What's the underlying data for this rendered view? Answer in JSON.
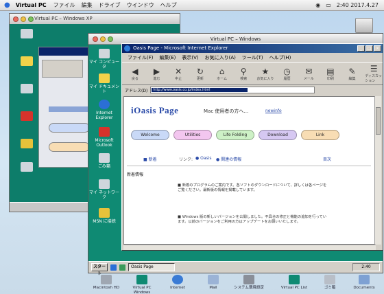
{
  "mac_menubar": {
    "app_name": "Virtual PC",
    "menus": [
      "ファイル",
      "編集",
      "ドライブ",
      "ウインドウ",
      "ヘルプ"
    ],
    "clock": "2:40 2017.4.27"
  },
  "back_window": {
    "title": "Virtual PC – Windows XP"
  },
  "front_window": {
    "title": "Virtual PC – Windows"
  },
  "desktop_icons": [
    {
      "label": "マイ コンピュータ",
      "color": "#cfd6dc"
    },
    {
      "label": "マイ ドキュメント",
      "color": "#f2d24a"
    },
    {
      "label": "Internet Explorer",
      "color": "#2b6fd6"
    },
    {
      "label": "Microsoft Outlook",
      "color": "#d6332b"
    },
    {
      "label": "ごみ箱",
      "color": "#cfd6dc"
    },
    {
      "label": "マイ ネットワーク",
      "color": "#cfd6dc"
    },
    {
      "label": "MSN に接続",
      "color": "#e6c23a"
    }
  ],
  "ie": {
    "title": "Oasis Page - Microsoft Internet Explorer",
    "menu": [
      "ファイル(F)",
      "編集(E)",
      "表示(V)",
      "お気に入り(A)",
      "ツール(T)",
      "ヘルプ(H)"
    ],
    "toolbar": [
      "戻る",
      "進む",
      "中止",
      "更新",
      "ホーム",
      "検索",
      "お気に入り",
      "履歴",
      "メール",
      "印刷",
      "編集",
      "ディスカッション"
    ],
    "address_label": "アドレス(D)",
    "address_value": "http://www.oasis.co.jp/index.html",
    "page": {
      "brand": "iOasis Page",
      "brand_sub": "Mac 使用者の方へ…",
      "brand_link": "newinfo",
      "pills": [
        {
          "label": "Welcome",
          "color": "#c9d9f7"
        },
        {
          "label": "Utilities",
          "color": "#f3c6ef"
        },
        {
          "label": "Life Folding",
          "color": "#cdf1c6"
        },
        {
          "label": "Download",
          "color": "#d6c8f2"
        },
        {
          "label": "Link",
          "color": "#f8ddb4"
        }
      ],
      "nav": [
        "■ 新着",
        "リンク:",
        "● Oasis",
        "● 関連の情報"
      ],
      "nav_right": "目次",
      "section_title": "新着情報",
      "paragraphs": [
        "■ 新着のプログラムのご案内です。各ソフトのダウンロードについて、詳しくは各ページをご覧ください。最新版の情報を掲載しています。",
        "■ Windows 版の新しいバージョンを公開しました。不具合の修正と機能の追加を行っています。以前のバージョンをご利用の方はアップデートをお願いいたします。"
      ]
    }
  },
  "win_taskbar": {
    "start": "スタート",
    "task": "Oasis Page",
    "tray": "2:40"
  },
  "dock": [
    {
      "label": "Macintosh HD",
      "color": "#9fa7b2"
    },
    {
      "label": "Virtual PC Windows",
      "color": "#0f8a73"
    },
    {
      "label": "Internet",
      "color": "#3a7bd5"
    },
    {
      "label": "Mail",
      "color": "#9bb3d6"
    },
    {
      "label": "システム環境設定",
      "color": "#8a8f99"
    },
    {
      "label": "Virtual PC List",
      "color": "#0f8a73"
    },
    {
      "label": "ゴミ箱",
      "color": "#b8bec7"
    },
    {
      "label": "Documents",
      "color": "#7ea1d3"
    }
  ],
  "colors": {
    "vpc_desktop": "#0f8a73",
    "ie_titlebar": "#0a246a",
    "aqua_blue": "#2a6ad8"
  }
}
